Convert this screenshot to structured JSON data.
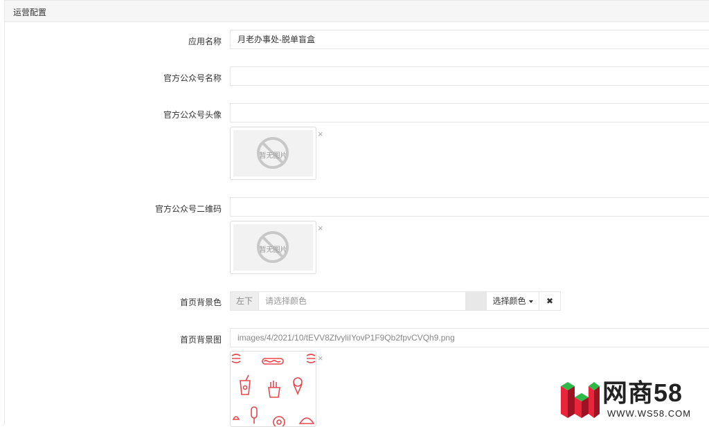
{
  "panel": {
    "title": "运营配置"
  },
  "fields": {
    "app_name": {
      "label": "应用名称",
      "value": "月老办事处-脱单盲盒"
    },
    "official_name": {
      "label": "官方公众号名称",
      "value": ""
    },
    "official_avatar": {
      "label": "官方公众号头像",
      "value": "",
      "placeholder_text": "暂无图片"
    },
    "official_qrcode": {
      "label": "官方公众号二维码",
      "value": "",
      "placeholder_text": "暂无图片"
    },
    "home_bg_color": {
      "label": "首页背景色",
      "addon": "左下",
      "placeholder": "请选择颜色",
      "pick_label": "选择颜色",
      "clear_label": "✖"
    },
    "home_bg_image": {
      "label": "首页背景图",
      "value": "images/4/2021/10/tEVV8ZfvyliIYovP1F9Qb2fpvCVQh9.png"
    }
  },
  "remove_mark": "×",
  "watermark": {
    "brand": "网商58",
    "url": "WWW.WS58.COM"
  },
  "colors": {
    "accent_red": "#e83c3c",
    "pattern_red": "#e8464c"
  }
}
